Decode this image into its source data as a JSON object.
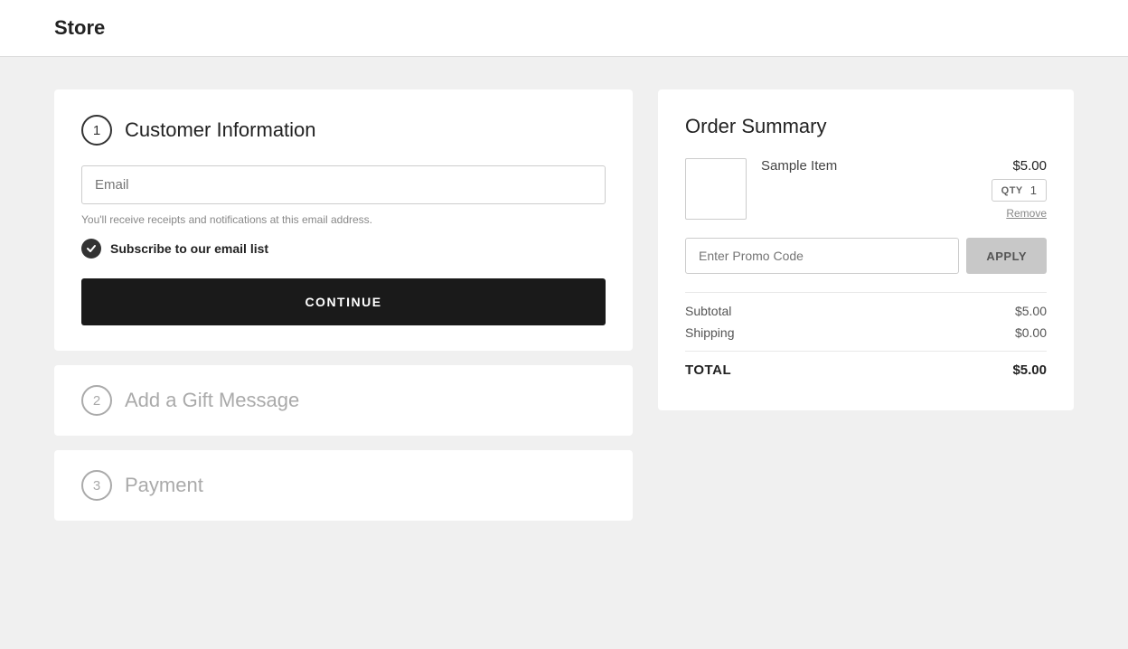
{
  "header": {
    "title": "Store"
  },
  "steps": {
    "step1": {
      "number": "1",
      "title": "Customer Information",
      "email_placeholder": "Email",
      "helper_text": "You'll receive receipts and notifications at this email address.",
      "subscribe_label": "Subscribe to our email list",
      "continue_label": "CONTINUE"
    },
    "step2": {
      "number": "2",
      "title": "Add a Gift Message"
    },
    "step3": {
      "number": "3",
      "title": "Payment"
    }
  },
  "order_summary": {
    "title": "Order Summary",
    "item": {
      "name": "Sample Item",
      "price": "$5.00",
      "qty_label": "QTY",
      "qty_value": "1",
      "remove_label": "Remove"
    },
    "promo": {
      "placeholder": "Enter Promo Code",
      "apply_label": "APPLY"
    },
    "subtotal_label": "Subtotal",
    "subtotal_value": "$5.00",
    "shipping_label": "Shipping",
    "shipping_value": "$0.00",
    "total_label": "TOTAL",
    "total_value": "$5.00"
  }
}
